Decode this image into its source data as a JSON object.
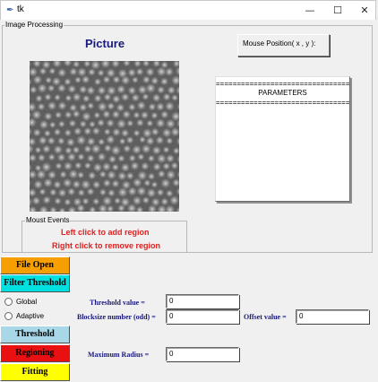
{
  "window": {
    "title": "tk",
    "controls": {
      "minimize": "—",
      "maximize": "☐",
      "close": "✕"
    }
  },
  "image_frame": {
    "label": "Image Processing",
    "picture_title": "Picture",
    "mouse_position_label": "Mouse Position( x , y ):",
    "parameters": {
      "separator": "=================================",
      "title": "PARAMETERS"
    }
  },
  "mouse_events": {
    "label": "Moust Events",
    "left_click": "Left click to add region",
    "right_click": "Right click to remove region"
  },
  "buttons": {
    "file_open": {
      "label": "File Open",
      "color": "#f5a000"
    },
    "filter_threshold": {
      "label": "Filter Threshold",
      "color": "#00e0e0"
    },
    "threshold": {
      "label": "Threshold",
      "color": "#a8d8e8"
    },
    "regioning": {
      "label": "Regioning",
      "color": "#e81010"
    },
    "fitting": {
      "label": "Fitting",
      "color": "#ffff00"
    }
  },
  "radios": {
    "global": "Global",
    "adaptive": "Adaptive"
  },
  "fields": {
    "threshold_value": {
      "label": "Threshold value =",
      "value": "0"
    },
    "blocksize": {
      "label": "Blocksize number (odd) =",
      "value": "0"
    },
    "offset": {
      "label": "Offset value =",
      "value": "0"
    },
    "max_radius": {
      "label": "Maximum Radius =",
      "value": "0"
    }
  }
}
